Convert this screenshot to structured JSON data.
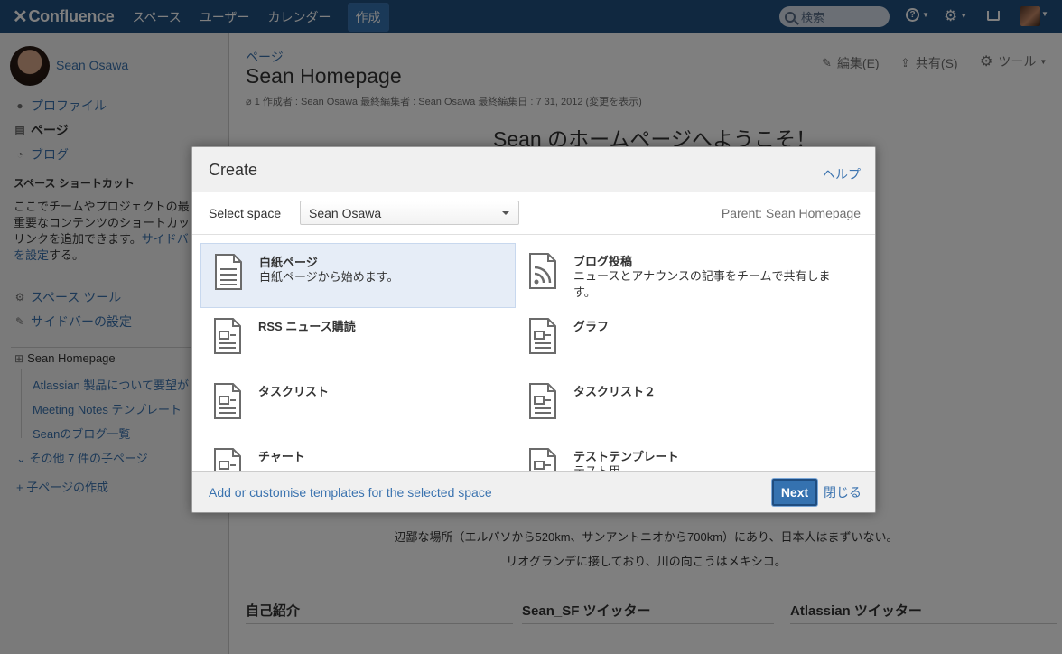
{
  "topnav": {
    "logo": "Confluence",
    "links": [
      "スペース",
      "ユーザー",
      "カレンダー"
    ],
    "create_label": "作成",
    "search_placeholder": "検索"
  },
  "sidebar": {
    "user_name": "Sean Osawa",
    "items": [
      {
        "label": "プロファイル",
        "icon": "person-icon"
      },
      {
        "label": "ページ",
        "icon": "pages-icon"
      },
      {
        "label": "ブログ",
        "icon": "rss-icon"
      }
    ],
    "shortcuts_heading": "スペース ショートカット",
    "shortcuts_text": [
      "ここでチームやプロジェクトの最",
      "重要なコンテンツのショートカッ",
      "リンクを追加できます。",
      "を設定する。"
    ],
    "shortcuts_link1": "サイドバ",
    "shortcuts_link2": "を設定",
    "shortcuts_suffix": "する。",
    "tools": [
      "スペース ツール",
      "サイドバーの設定"
    ],
    "tree_root": "Sean Homepage",
    "tree_children": [
      "Atlassian 製品について要望が",
      "Meeting Notes テンプレート",
      "Seanのブログ一覧"
    ],
    "tree_more": "その他 7 件の子ページ",
    "tree_add": "子ページの作成"
  },
  "page": {
    "breadcrumb": "ページ",
    "title": "Sean Homepage",
    "meta": "1 作成者 : Sean Osawa 最終編集者 : Sean Osawa 最終編集日 : 7 31, 2012  (変更を表示)",
    "actions": {
      "edit": "編集(E)",
      "share": "共有(S)",
      "tools": "ツール"
    },
    "welcome": "Sean のホームページへようこそ！",
    "body_lines": [
      "辺鄙な場所（エルパソから520km、サンアントニオから700km）にあり、日本人はまずいない。",
      "リオグランデに接しており、川の向こうはメキシコ。"
    ],
    "sections": [
      "自己紹介",
      "Sean_SF ツイッター",
      "Atlassian ツイッター"
    ]
  },
  "dialog": {
    "title": "Create",
    "help": "ヘルプ",
    "select_space_label": "Select space",
    "space_value": "Sean Osawa",
    "parent": "Parent: Sean Homepage",
    "templates": [
      {
        "name": "白紙ページ",
        "desc": "白紙ページから始めます。",
        "icon": "blank-page-icon",
        "selected": true
      },
      {
        "name": "ブログ投稿",
        "desc": "ニュースとアナウンスの記事をチームで共有します。",
        "icon": "blog-post-icon",
        "selected": false
      },
      {
        "name": "RSS ニュース購読",
        "desc": "",
        "icon": "template-page-icon",
        "selected": false
      },
      {
        "name": "グラフ",
        "desc": "",
        "icon": "template-page-icon",
        "selected": false
      },
      {
        "name": "タスクリスト",
        "desc": "",
        "icon": "template-page-icon",
        "selected": false
      },
      {
        "name": "タスクリスト２",
        "desc": "",
        "icon": "template-page-icon",
        "selected": false
      },
      {
        "name": "チャート",
        "desc": "",
        "icon": "template-page-icon",
        "selected": false
      },
      {
        "name": "テストテンプレート",
        "desc": "テスト用",
        "icon": "template-page-icon",
        "selected": false
      }
    ],
    "footer_link": "Add or customise templates for the selected space",
    "next_label": "Next",
    "close_label": "閉じる"
  }
}
